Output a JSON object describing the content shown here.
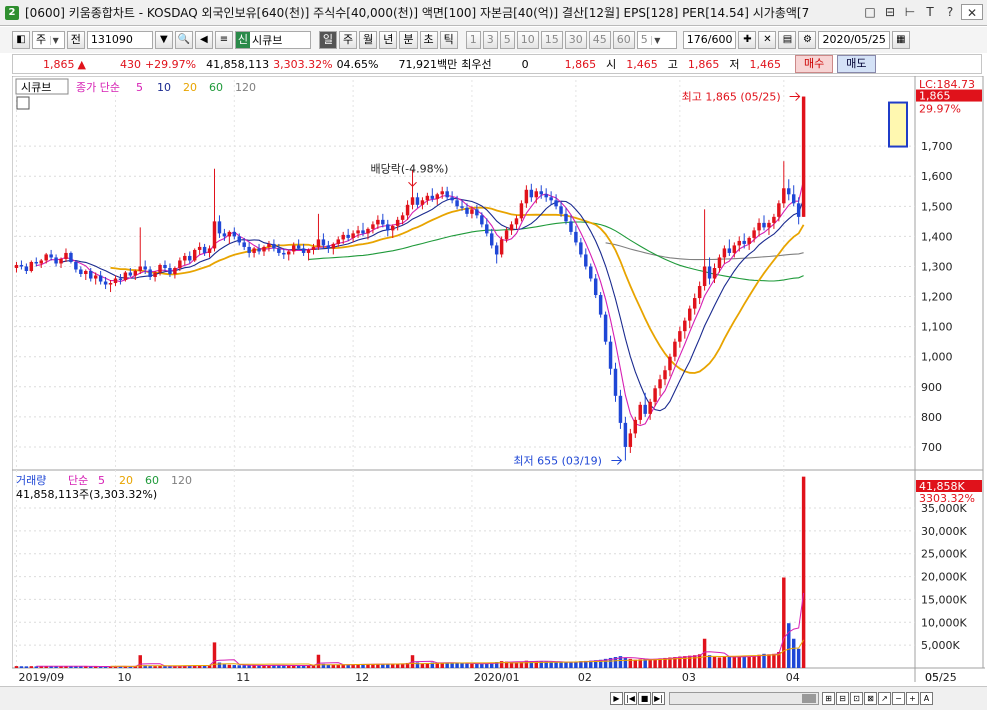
{
  "window": {
    "badge": "2",
    "title": "[0600] 키움종합차트 - KOSDAQ 외국인보유[640(천)] 주식수[40,000(천)] 액면[100] 자본금[40(억)] 결산[12월] EPS[128] PER[14.54] 시가총액[7",
    "buttons": [
      "□",
      "⊟",
      "⊢",
      "T",
      "?",
      "✕"
    ]
  },
  "toolbar": {
    "period": "주",
    "prev_label": "전",
    "code": "131090",
    "name_tag": "신",
    "stock_name": "시큐브",
    "periods": [
      "일",
      "주",
      "월",
      "년",
      "분",
      "초",
      "틱"
    ],
    "active_period": "일",
    "intervals": [
      "1",
      "3",
      "5",
      "10",
      "15",
      "30",
      "45",
      "60"
    ],
    "interval_value": "5",
    "count": "176/600",
    "date": "2020/05/25"
  },
  "quote": {
    "price": "1,865",
    "change": "430",
    "change_pct": "+29.97%",
    "volume": "41,858,113",
    "volume_pct": "3,303.32%",
    "turnover": "04.65%",
    "amount": "71,921백만",
    "pref_label": "최우선",
    "pref_value": "0",
    "ask": "1,865",
    "open_label": "시",
    "open": "1,465",
    "high_label": "고",
    "high": "1,865",
    "low_label": "저",
    "low": "1,465",
    "buy_label": "매수",
    "sell_label": "매도"
  },
  "price_panel": {
    "stock_label": "시큐브",
    "ma_label": "종가 단순",
    "ma_periods": [
      "5",
      "10",
      "20",
      "60",
      "120"
    ],
    "lc_label": "LC:184.73",
    "current_price": "1,865",
    "current_pct": "29.97%",
    "high_annotation": "최고 1,865 (05/25)",
    "low_annotation": "최저 655 (03/19)",
    "dividend_annotation": "배당락(-4.98%)"
  },
  "volume_panel": {
    "title": "거래량",
    "ma_label": "단순",
    "ma_periods": [
      "5",
      "20",
      "60",
      "120"
    ],
    "volume_text": "41,858,113주(3,303.32%)",
    "current_volume": "41,858K",
    "current_pct": "3303.32%"
  },
  "colors": {
    "up": "#e0121b",
    "down": "#1f47d6",
    "ma5": "#d61fb4",
    "ma10": "#1a2a8f",
    "ma20": "#e8a400",
    "ma60": "#1f9a3a",
    "ma120": "#808080"
  },
  "chart_data": {
    "type": "candlestick",
    "price_axis": {
      "ticks": [
        "1,700",
        "1,600",
        "1,500",
        "1,400",
        "1,300",
        "1,200",
        "1,100",
        "1,000",
        "900",
        "800",
        "700"
      ],
      "tick_values": [
        1700,
        1600,
        1500,
        1400,
        1300,
        1200,
        1100,
        1000,
        900,
        800,
        700
      ],
      "range": [
        630,
        1920
      ]
    },
    "volume_axis": {
      "ticks": [
        "35,000K",
        "30,000K",
        "25,000K",
        "20,000K",
        "15,000K",
        "10,000K",
        "5,000K"
      ],
      "tick_values": [
        35000,
        30000,
        25000,
        20000,
        15000,
        10000,
        5000
      ],
      "range": [
        0,
        42000
      ]
    },
    "x_labels": [
      "2019/09",
      "10",
      "11",
      "12",
      "2020/01",
      "02",
      "03",
      "04",
      "05",
      "05/25"
    ],
    "x_label_index": [
      0,
      20,
      44,
      68,
      92,
      113,
      134,
      155,
      176,
      200
    ],
    "candles": [
      [
        1295,
        1315,
        1280,
        1305
      ],
      [
        1305,
        1320,
        1290,
        1300
      ],
      [
        1300,
        1310,
        1275,
        1285
      ],
      [
        1285,
        1320,
        1280,
        1315
      ],
      [
        1315,
        1330,
        1300,
        1310
      ],
      [
        1310,
        1325,
        1295,
        1320
      ],
      [
        1320,
        1345,
        1310,
        1340
      ],
      [
        1340,
        1355,
        1320,
        1330
      ],
      [
        1330,
        1340,
        1300,
        1310
      ],
      [
        1310,
        1330,
        1295,
        1325
      ],
      [
        1325,
        1360,
        1315,
        1345
      ],
      [
        1345,
        1350,
        1310,
        1315
      ],
      [
        1315,
        1320,
        1280,
        1290
      ],
      [
        1290,
        1300,
        1265,
        1275
      ],
      [
        1275,
        1290,
        1255,
        1285
      ],
      [
        1285,
        1295,
        1250,
        1260
      ],
      [
        1260,
        1280,
        1240,
        1270
      ],
      [
        1270,
        1285,
        1240,
        1250
      ],
      [
        1250,
        1265,
        1225,
        1240
      ],
      [
        1240,
        1255,
        1215,
        1245
      ],
      [
        1245,
        1270,
        1235,
        1260
      ],
      [
        1260,
        1275,
        1240,
        1255
      ],
      [
        1255,
        1285,
        1250,
        1280
      ],
      [
        1280,
        1295,
        1265,
        1270
      ],
      [
        1270,
        1290,
        1255,
        1285
      ],
      [
        1285,
        1430,
        1275,
        1300
      ],
      [
        1300,
        1320,
        1275,
        1290
      ],
      [
        1290,
        1300,
        1255,
        1265
      ],
      [
        1265,
        1285,
        1250,
        1280
      ],
      [
        1280,
        1310,
        1270,
        1305
      ],
      [
        1305,
        1320,
        1285,
        1295
      ],
      [
        1295,
        1310,
        1265,
        1275
      ],
      [
        1275,
        1300,
        1260,
        1295
      ],
      [
        1295,
        1330,
        1285,
        1320
      ],
      [
        1320,
        1345,
        1305,
        1335
      ],
      [
        1335,
        1350,
        1310,
        1320
      ],
      [
        1320,
        1360,
        1315,
        1355
      ],
      [
        1355,
        1380,
        1340,
        1365
      ],
      [
        1365,
        1375,
        1335,
        1345
      ],
      [
        1345,
        1370,
        1330,
        1360
      ],
      [
        1360,
        1625,
        1350,
        1450
      ],
      [
        1450,
        1470,
        1395,
        1410
      ],
      [
        1410,
        1425,
        1385,
        1400
      ],
      [
        1400,
        1420,
        1375,
        1415
      ],
      [
        1415,
        1430,
        1390,
        1400
      ],
      [
        1400,
        1410,
        1370,
        1380
      ],
      [
        1380,
        1395,
        1355,
        1365
      ],
      [
        1365,
        1380,
        1330,
        1345
      ],
      [
        1345,
        1365,
        1330,
        1360
      ],
      [
        1360,
        1375,
        1340,
        1350
      ],
      [
        1350,
        1370,
        1335,
        1365
      ],
      [
        1365,
        1385,
        1350,
        1375
      ],
      [
        1375,
        1390,
        1350,
        1360
      ],
      [
        1360,
        1375,
        1335,
        1345
      ],
      [
        1345,
        1360,
        1325,
        1340
      ],
      [
        1340,
        1355,
        1320,
        1350
      ],
      [
        1350,
        1380,
        1340,
        1370
      ],
      [
        1370,
        1390,
        1355,
        1360
      ],
      [
        1360,
        1375,
        1335,
        1345
      ],
      [
        1345,
        1360,
        1320,
        1355
      ],
      [
        1355,
        1375,
        1340,
        1365
      ],
      [
        1365,
        1475,
        1355,
        1390
      ],
      [
        1390,
        1410,
        1360,
        1370
      ],
      [
        1370,
        1385,
        1345,
        1360
      ],
      [
        1360,
        1380,
        1340,
        1375
      ],
      [
        1375,
        1400,
        1365,
        1390
      ],
      [
        1390,
        1415,
        1375,
        1405
      ],
      [
        1405,
        1425,
        1385,
        1395
      ],
      [
        1395,
        1420,
        1380,
        1410
      ],
      [
        1410,
        1435,
        1395,
        1420
      ],
      [
        1420,
        1445,
        1400,
        1410
      ],
      [
        1410,
        1430,
        1390,
        1425
      ],
      [
        1425,
        1450,
        1410,
        1440
      ],
      [
        1440,
        1470,
        1425,
        1455
      ],
      [
        1455,
        1475,
        1430,
        1440
      ],
      [
        1440,
        1455,
        1400,
        1420
      ],
      [
        1420,
        1440,
        1395,
        1435
      ],
      [
        1435,
        1465,
        1420,
        1455
      ],
      [
        1455,
        1480,
        1440,
        1470
      ],
      [
        1470,
        1520,
        1455,
        1505
      ],
      [
        1505,
        1620,
        1490,
        1530
      ],
      [
        1530,
        1545,
        1495,
        1505
      ],
      [
        1505,
        1530,
        1490,
        1520
      ],
      [
        1520,
        1545,
        1505,
        1535
      ],
      [
        1535,
        1560,
        1515,
        1525
      ],
      [
        1525,
        1545,
        1505,
        1540
      ],
      [
        1540,
        1565,
        1525,
        1550
      ],
      [
        1550,
        1565,
        1520,
        1530
      ],
      [
        1530,
        1550,
        1510,
        1520
      ],
      [
        1520,
        1535,
        1490,
        1500
      ],
      [
        1500,
        1520,
        1485,
        1495
      ],
      [
        1495,
        1510,
        1465,
        1475
      ],
      [
        1475,
        1500,
        1460,
        1490
      ],
      [
        1490,
        1505,
        1460,
        1470
      ],
      [
        1470,
        1480,
        1430,
        1440
      ],
      [
        1440,
        1460,
        1400,
        1410
      ],
      [
        1410,
        1425,
        1360,
        1370
      ],
      [
        1370,
        1380,
        1310,
        1340
      ],
      [
        1340,
        1400,
        1330,
        1390
      ],
      [
        1390,
        1430,
        1380,
        1420
      ],
      [
        1420,
        1450,
        1405,
        1440
      ],
      [
        1440,
        1470,
        1425,
        1460
      ],
      [
        1460,
        1520,
        1450,
        1510
      ],
      [
        1510,
        1570,
        1495,
        1555
      ],
      [
        1555,
        1575,
        1515,
        1530
      ],
      [
        1530,
        1560,
        1510,
        1550
      ],
      [
        1550,
        1570,
        1525,
        1540
      ],
      [
        1540,
        1560,
        1515,
        1530
      ],
      [
        1530,
        1550,
        1505,
        1520
      ],
      [
        1520,
        1540,
        1490,
        1500
      ],
      [
        1500,
        1515,
        1465,
        1475
      ],
      [
        1475,
        1495,
        1440,
        1450
      ],
      [
        1450,
        1470,
        1405,
        1415
      ],
      [
        1415,
        1435,
        1370,
        1380
      ],
      [
        1380,
        1395,
        1330,
        1340
      ],
      [
        1340,
        1360,
        1290,
        1300
      ],
      [
        1300,
        1310,
        1250,
        1260
      ],
      [
        1260,
        1275,
        1195,
        1205
      ],
      [
        1205,
        1215,
        1130,
        1140
      ],
      [
        1140,
        1150,
        1040,
        1050
      ],
      [
        1050,
        1070,
        940,
        960
      ],
      [
        960,
        980,
        850,
        870
      ],
      [
        870,
        890,
        760,
        780
      ],
      [
        780,
        800,
        655,
        700
      ],
      [
        700,
        760,
        680,
        745
      ],
      [
        745,
        800,
        730,
        790
      ],
      [
        790,
        850,
        775,
        840
      ],
      [
        840,
        880,
        800,
        810
      ],
      [
        810,
        860,
        790,
        850
      ],
      [
        850,
        905,
        835,
        895
      ],
      [
        895,
        940,
        870,
        925
      ],
      [
        925,
        970,
        905,
        955
      ],
      [
        955,
        1010,
        935,
        1000
      ],
      [
        1000,
        1060,
        985,
        1050
      ],
      [
        1050,
        1100,
        1030,
        1085
      ],
      [
        1085,
        1130,
        1060,
        1120
      ],
      [
        1120,
        1170,
        1095,
        1160
      ],
      [
        1160,
        1210,
        1140,
        1195
      ],
      [
        1195,
        1250,
        1175,
        1235
      ],
      [
        1235,
        1490,
        1220,
        1300
      ],
      [
        1300,
        1330,
        1240,
        1260
      ],
      [
        1260,
        1310,
        1245,
        1295
      ],
      [
        1295,
        1340,
        1280,
        1330
      ],
      [
        1330,
        1370,
        1310,
        1360
      ],
      [
        1360,
        1390,
        1335,
        1345
      ],
      [
        1345,
        1380,
        1330,
        1370
      ],
      [
        1370,
        1400,
        1350,
        1385
      ],
      [
        1385,
        1410,
        1360,
        1375
      ],
      [
        1375,
        1400,
        1355,
        1395
      ],
      [
        1395,
        1430,
        1380,
        1420
      ],
      [
        1420,
        1460,
        1400,
        1445
      ],
      [
        1445,
        1470,
        1420,
        1430
      ],
      [
        1430,
        1455,
        1405,
        1445
      ],
      [
        1445,
        1475,
        1425,
        1465
      ],
      [
        1465,
        1520,
        1450,
        1510
      ],
      [
        1510,
        1650,
        1495,
        1560
      ],
      [
        1560,
        1590,
        1520,
        1540
      ],
      [
        1540,
        1570,
        1500,
        1510
      ],
      [
        1510,
        1530,
        1440,
        1465
      ],
      [
        1465,
        1865,
        1465,
        1865
      ]
    ],
    "volumes": [
      420,
      380,
      360,
      400,
      350,
      380,
      420,
      390,
      370,
      360,
      410,
      380,
      360,
      350,
      340,
      330,
      320,
      350,
      340,
      330,
      350,
      340,
      380,
      360,
      370,
      2800,
      600,
      420,
      400,
      450,
      420,
      380,
      400,
      480,
      520,
      500,
      540,
      580,
      520,
      560,
      5600,
      1200,
      800,
      700,
      650,
      600,
      580,
      560,
      540,
      520,
      560,
      600,
      580,
      540,
      520,
      510,
      560,
      600,
      560,
      540,
      580,
      2900,
      900,
      700,
      680,
      720,
      760,
      740,
      780,
      820,
      800,
      790,
      850,
      900,
      880,
      840,
      860,
      920,
      980,
      1100,
      2800,
      1200,
      1000,
      1100,
      1200,
      1100,
      1150,
      1200,
      1100,
      1000,
      980,
      960,
      940,
      920,
      950,
      1000,
      1100,
      1300,
      1500,
      1400,
      1300,
      1250,
      1400,
      1600,
      1500,
      1450,
      1500,
      1400,
      1350,
      1300,
      1250,
      1200,
      1300,
      1400,
      1500,
      1550,
      1600,
      1700,
      1800,
      2000,
      2200,
      2400,
      2600,
      2200,
      2000,
      1800,
      1900,
      2000,
      1900,
      2000,
      2100,
      2200,
      2300,
      2400,
      2500,
      2600,
      2700,
      2800,
      3000,
      6400,
      2800,
      2400,
      2300,
      2400,
      2500,
      2400,
      2500,
      2600,
      2500,
      2700,
      2900,
      3100,
      3000,
      3100,
      3500,
      19800,
      9800,
      6400,
      4200,
      41858
    ]
  }
}
